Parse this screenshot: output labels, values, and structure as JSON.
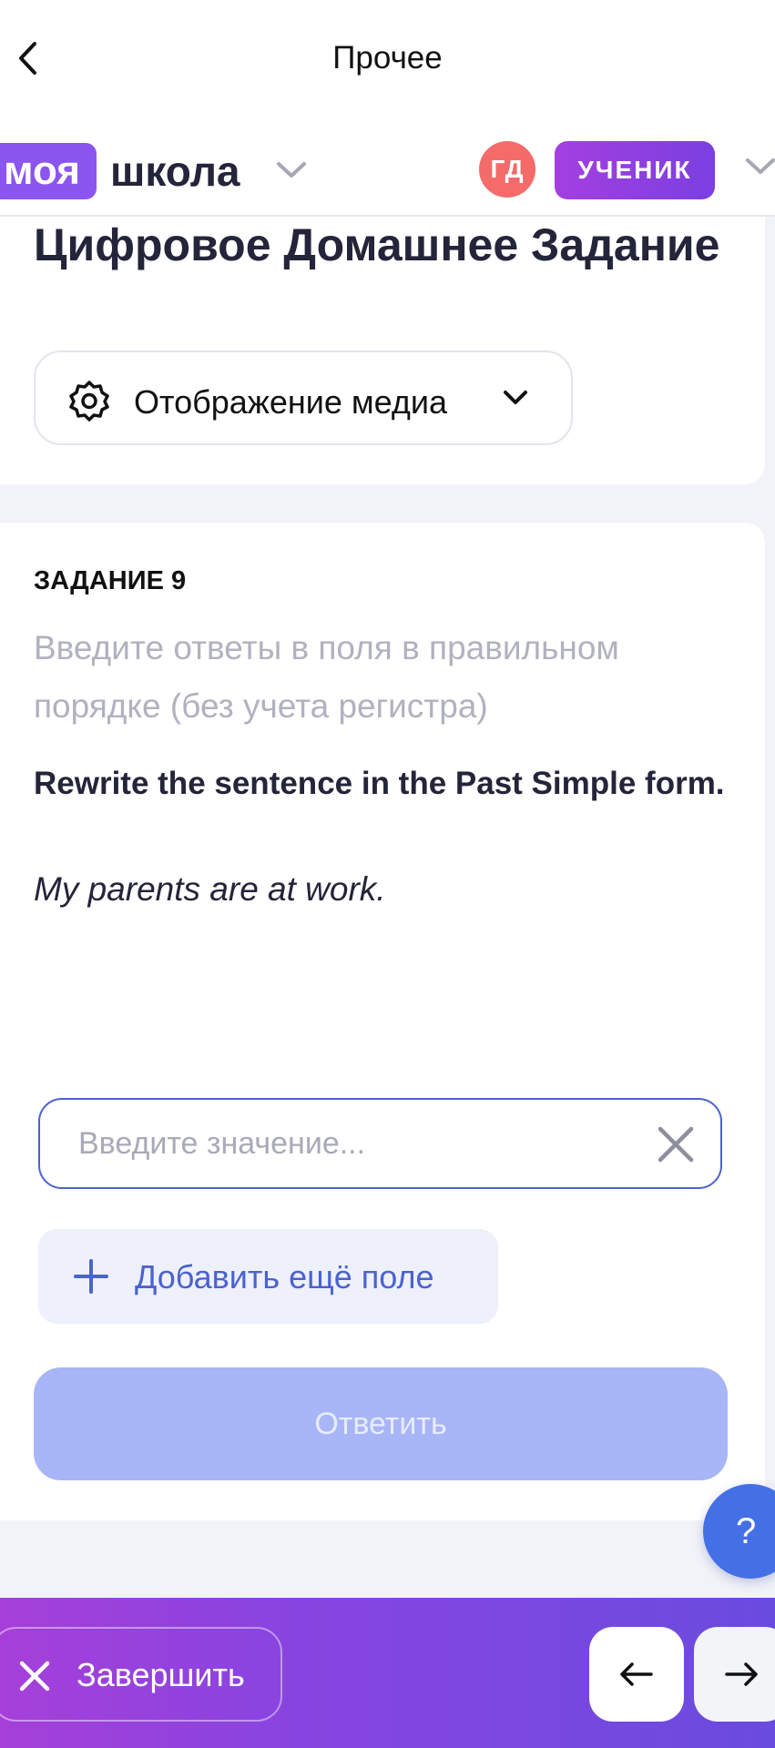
{
  "header": {
    "title": "Прочее",
    "back_icon": "chevron-left-icon"
  },
  "brand": {
    "logo_part1": "моя",
    "logo_part2": "школа",
    "user_initials": "ГД",
    "role": "УЧЕНИК"
  },
  "page": {
    "title": "Цифровое Домашнее Задание",
    "media_select_label": "Отображение медиа"
  },
  "task": {
    "number_label": "ЗАДАНИЕ 9",
    "hint": "Введите ответы в поля в правильном порядке (без учета регистра)",
    "question": "Rewrite the sentence in the Past Simple form.",
    "example": "My parents are at work.",
    "input_placeholder": "Введите значение...",
    "input_value": "",
    "add_field_label": "Добавить ещё поле",
    "submit_label": "Ответить"
  },
  "help": {
    "label": "?"
  },
  "bottom": {
    "finish_label": "Завершить"
  },
  "colors": {
    "accent_purple": "#8b55f0",
    "accent_blue": "#4b62d0",
    "avatar_red": "#f46b6a",
    "submit_disabled": "#a8b5f7"
  }
}
